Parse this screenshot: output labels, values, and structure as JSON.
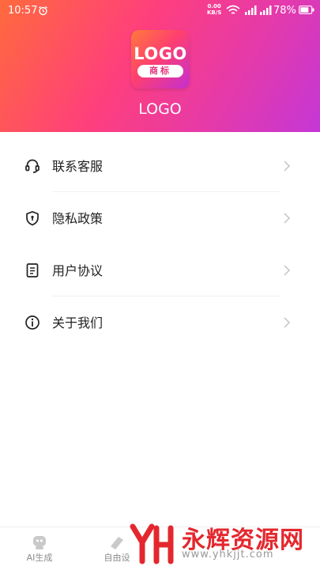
{
  "status_bar": {
    "time": "10:57",
    "net_speed_value": "0.00",
    "net_speed_unit": "KB/S",
    "battery": "78%"
  },
  "header": {
    "logo_main": "LOGO",
    "logo_sub": "商标",
    "app_name": "LOGO"
  },
  "menu": {
    "items": [
      {
        "label": "联系客服",
        "icon": "headset-icon"
      },
      {
        "label": "隐私政策",
        "icon": "shield-icon"
      },
      {
        "label": "用户协议",
        "icon": "document-icon"
      },
      {
        "label": "关于我们",
        "icon": "info-icon"
      }
    ]
  },
  "tabbar": {
    "tabs": [
      {
        "label": "AI生成",
        "icon": "robot-icon"
      },
      {
        "label": "自由设",
        "icon": "design-icon"
      }
    ]
  },
  "watermark": {
    "text": "永辉资源网",
    "url": "www.yhkjjt.com"
  },
  "colors": {
    "header_start": "#ff6a3d",
    "header_end": "#c437d6",
    "watermark_red": "#e4272e"
  }
}
